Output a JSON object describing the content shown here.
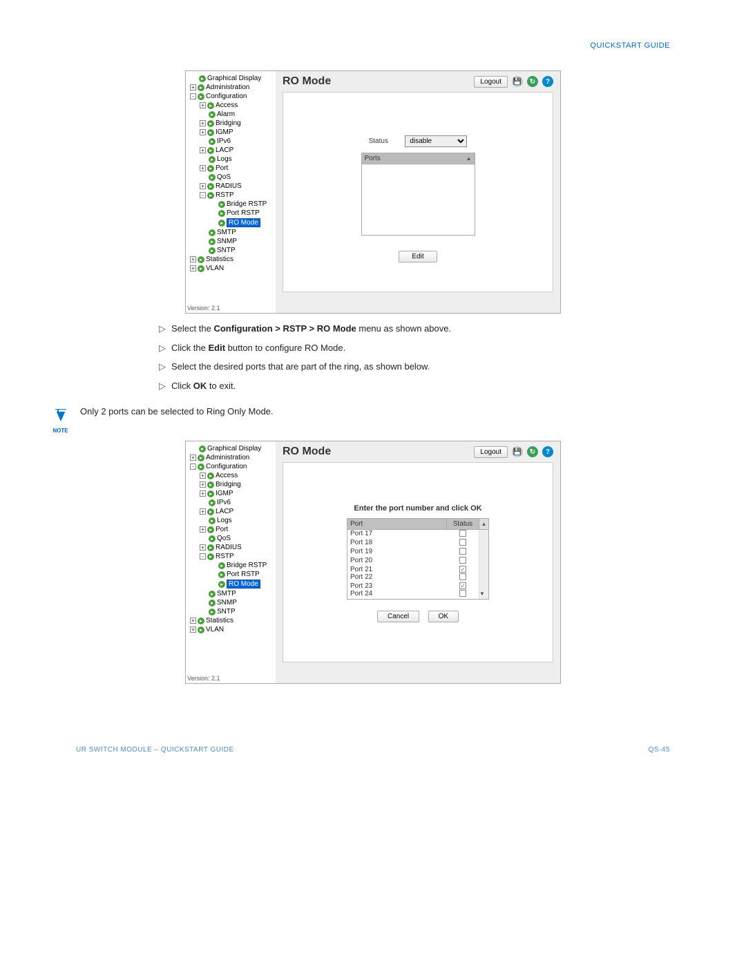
{
  "header": "QUICKSTART GUIDE",
  "footer": {
    "left": "UR SWITCH MODULE – QUICKSTART GUIDE",
    "right": "QS-45"
  },
  "panel_title": "RO Mode",
  "logout": "Logout",
  "version": "Version: 2.1",
  "tree1": [
    {
      "depth": "d1",
      "exp": "",
      "label": "Graphical Display"
    },
    {
      "depth": "d1",
      "exp": "+",
      "label": "Administration"
    },
    {
      "depth": "d1",
      "exp": "-",
      "label": "Configuration"
    },
    {
      "depth": "d2",
      "exp": "+",
      "label": "Access"
    },
    {
      "depth": "d2",
      "exp": "",
      "label": "Alarm"
    },
    {
      "depth": "d2",
      "exp": "+",
      "label": "Bridging"
    },
    {
      "depth": "d2",
      "exp": "+",
      "label": "IGMP"
    },
    {
      "depth": "d2",
      "exp": "",
      "label": "IPv6"
    },
    {
      "depth": "d2",
      "exp": "+",
      "label": "LACP"
    },
    {
      "depth": "d2",
      "exp": "",
      "label": "Logs"
    },
    {
      "depth": "d2",
      "exp": "+",
      "label": "Port"
    },
    {
      "depth": "d2",
      "exp": "",
      "label": "QoS"
    },
    {
      "depth": "d2",
      "exp": "+",
      "label": "RADIUS"
    },
    {
      "depth": "d2",
      "exp": "-",
      "label": "RSTP"
    },
    {
      "depth": "d3",
      "exp": "",
      "label": "Bridge RSTP"
    },
    {
      "depth": "d3",
      "exp": "",
      "label": "Port RSTP"
    },
    {
      "depth": "d3",
      "exp": "",
      "label": "RO Mode",
      "sel": true
    },
    {
      "depth": "d2",
      "exp": "",
      "label": "SMTP"
    },
    {
      "depth": "d2",
      "exp": "",
      "label": "SNMP"
    },
    {
      "depth": "d2",
      "exp": "",
      "label": "SNTP"
    },
    {
      "depth": "d1",
      "exp": "+",
      "label": "Statistics"
    },
    {
      "depth": "d1",
      "exp": "+",
      "label": "VLAN"
    }
  ],
  "tree2": [
    {
      "depth": "d1",
      "exp": "",
      "label": "Graphical Display"
    },
    {
      "depth": "d1",
      "exp": "+",
      "label": "Administration"
    },
    {
      "depth": "d1",
      "exp": "-",
      "label": "Configuration"
    },
    {
      "depth": "d2",
      "exp": "+",
      "label": "Access"
    },
    {
      "depth": "d2",
      "exp": "+",
      "label": "Bridging"
    },
    {
      "depth": "d2",
      "exp": "+",
      "label": "IGMP"
    },
    {
      "depth": "d2",
      "exp": "",
      "label": "IPv6"
    },
    {
      "depth": "d2",
      "exp": "+",
      "label": "LACP"
    },
    {
      "depth": "d2",
      "exp": "",
      "label": "Logs"
    },
    {
      "depth": "d2",
      "exp": "+",
      "label": "Port"
    },
    {
      "depth": "d2",
      "exp": "",
      "label": "QoS"
    },
    {
      "depth": "d2",
      "exp": "+",
      "label": "RADIUS"
    },
    {
      "depth": "d2",
      "exp": "-",
      "label": "RSTP"
    },
    {
      "depth": "d3",
      "exp": "",
      "label": "Bridge RSTP"
    },
    {
      "depth": "d3",
      "exp": "",
      "label": "Port RSTP"
    },
    {
      "depth": "d3",
      "exp": "",
      "label": "RO Mode",
      "sel": true
    },
    {
      "depth": "d2",
      "exp": "",
      "label": "SMTP"
    },
    {
      "depth": "d2",
      "exp": "",
      "label": "SNMP"
    },
    {
      "depth": "d2",
      "exp": "",
      "label": "SNTP"
    },
    {
      "depth": "d1",
      "exp": "+",
      "label": "Statistics"
    },
    {
      "depth": "d1",
      "exp": "+",
      "label": "VLAN"
    }
  ],
  "status_label": "Status",
  "status_value": "disable",
  "ports_label": "Ports",
  "edit_label": "Edit",
  "instructions": {
    "i1a": "Select the ",
    "i1b": "Configuration > RSTP > RO Mode",
    "i1c": " menu as shown above.",
    "i2a": " Click the ",
    "i2b": "Edit",
    "i2c": " button to configure RO Mode.",
    "i3": "Select the desired ports that are part of the ring, as shown below.",
    "i4a": "Click ",
    "i4b": "OK",
    "i4c": " to exit."
  },
  "note_text": "Only 2 ports can be selected to Ring Only Mode.",
  "note_label": "NOTE",
  "enter_port": "Enter the port number and click OK",
  "port_header": {
    "port": "Port",
    "status": "Status"
  },
  "ports": [
    {
      "name": "Port 17",
      "checked": false
    },
    {
      "name": "Port 18",
      "checked": false
    },
    {
      "name": "Port 19",
      "checked": false
    },
    {
      "name": "Port 20",
      "checked": false
    },
    {
      "name": "Port 21",
      "checked": true
    },
    {
      "name": "Port 22",
      "checked": false
    },
    {
      "name": "Port 23",
      "checked": true
    },
    {
      "name": "Port 24",
      "checked": false
    }
  ],
  "cancel_label": "Cancel",
  "ok_label": "OK"
}
